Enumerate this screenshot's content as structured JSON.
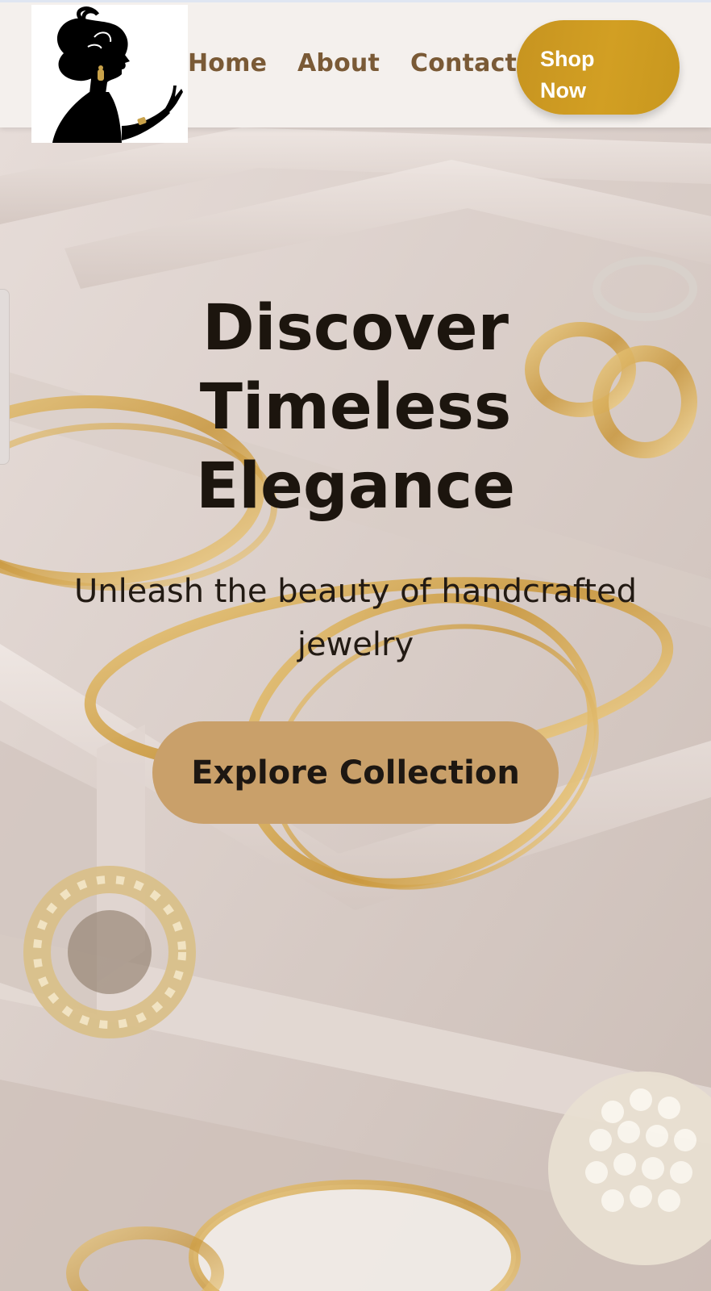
{
  "header": {
    "logo_alt": "woman silhouette logo",
    "nav": {
      "home": "Home",
      "about": "About",
      "contact": "Contact"
    },
    "shop_now_line1": "Shop",
    "shop_now_line2": "Now"
  },
  "hero": {
    "title_line1": "Discover",
    "title_line2": "Timeless",
    "title_line3": "Elegance",
    "subtitle": "Unleash the beauty of handcrafted jewelry",
    "cta_label": "Explore Collection",
    "background_description_icon": "jewelry-box-photo"
  },
  "colors": {
    "header_bg": "#f4f0ed",
    "nav_text": "#7a5a36",
    "shop_button": "#d29f23",
    "cta_button": "#c9a06a",
    "heading_text": "#1c150e"
  }
}
